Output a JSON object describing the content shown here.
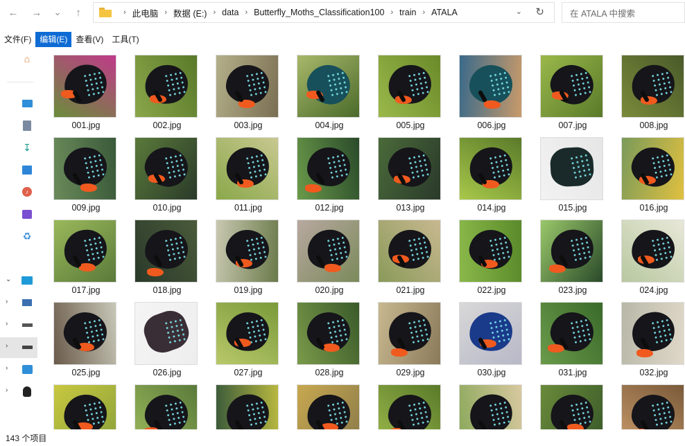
{
  "toolbar": {
    "back_glyph": "←",
    "forward_glyph": "→",
    "recent_glyph": "⌄",
    "up_glyph": "↑"
  },
  "address": {
    "breadcrumbs": [
      "此电脑",
      "数据 (E:)",
      "data",
      "Butterfly_Moths_Classification100",
      "train",
      "ATALA"
    ],
    "separator": "›"
  },
  "search": {
    "placeholder": "在 ATALA 中搜索"
  },
  "menu": {
    "items": [
      "文件(F)",
      "编辑(E)",
      "查看(V)",
      "工具(T)"
    ],
    "active_index": 1
  },
  "sidebar": {
    "icons": [
      "home-icon",
      "desktop-icon",
      "documents-icon",
      "downloads-icon",
      "pictures-icon",
      "music-icon",
      "videos-icon",
      "recycle-bin-icon",
      "this-pc-icon",
      "network-drive-icon",
      "drive-icon",
      "drive-selected-icon",
      "network-icon",
      "linux-icon"
    ]
  },
  "files": [
    "001.jpg",
    "002.jpg",
    "003.jpg",
    "004.jpg",
    "005.jpg",
    "006.jpg",
    "007.jpg",
    "008.jpg",
    "009.jpg",
    "010.jpg",
    "011.jpg",
    "012.jpg",
    "013.jpg",
    "014.jpg",
    "015.jpg",
    "016.jpg",
    "017.jpg",
    "018.jpg",
    "019.jpg",
    "020.jpg",
    "021.jpg",
    "022.jpg",
    "023.jpg",
    "024.jpg",
    "025.jpg",
    "026.jpg",
    "027.jpg",
    "028.jpg",
    "029.jpg",
    "030.jpg",
    "031.jpg",
    "032.jpg",
    "",
    "",
    "",
    "",
    "",
    "",
    "",
    ""
  ],
  "status": {
    "item_count": "143 个项目"
  },
  "colors": {
    "accent": "#0f6bd4",
    "folder": "#f5c542"
  }
}
